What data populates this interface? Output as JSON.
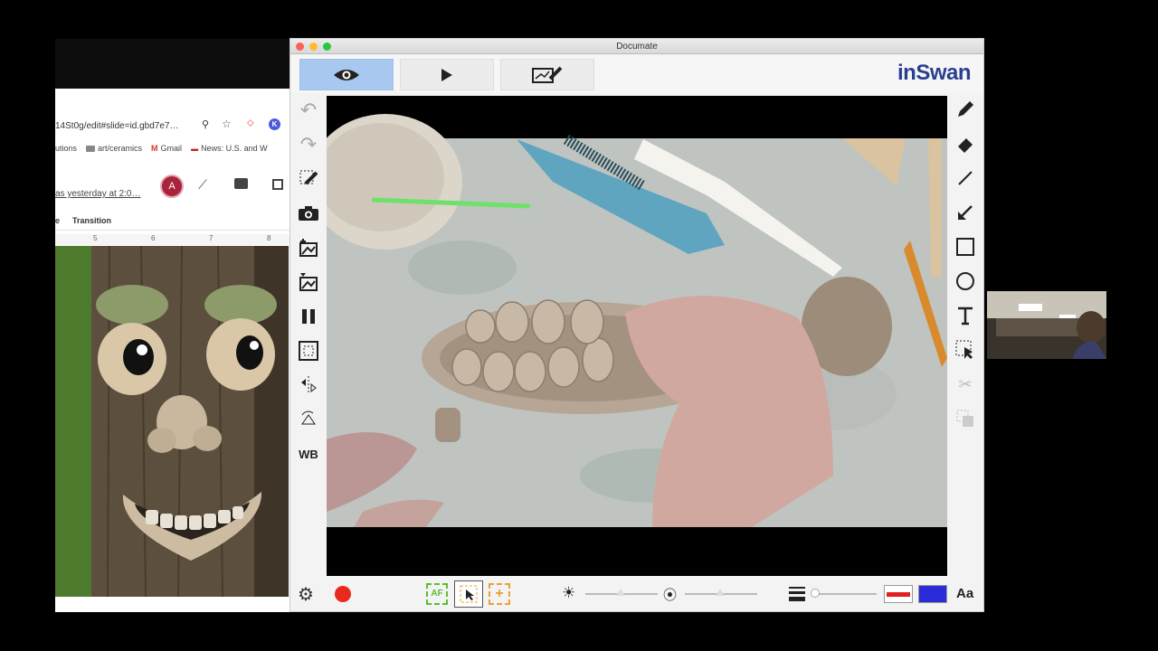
{
  "browser": {
    "url": "14St0g/edit#slide=id.gbd7e7…",
    "bookmarks": [
      {
        "label": "utions"
      },
      {
        "label": "art/ceramics"
      },
      {
        "label": "Gmail"
      },
      {
        "label": "News: U.S. and W"
      }
    ],
    "last_edit": "as yesterday at 2:0…",
    "avatar_letter": "A",
    "menu_items": [
      "e",
      "Transition"
    ],
    "ruler_ticks": [
      "5",
      "6",
      "7",
      "8"
    ]
  },
  "documate": {
    "title": "Documate",
    "brand": "inSwan",
    "left_tool_wb": "WB",
    "aa_label": "Aa",
    "af_label": "AF",
    "colors": {
      "accent_active": "#a8c8f0",
      "record": "#e8291c",
      "pen_color": "#e02020",
      "fill_color": "#2b2bd9",
      "af_green": "#5bbf2c",
      "af_orange": "#f0a030"
    }
  }
}
